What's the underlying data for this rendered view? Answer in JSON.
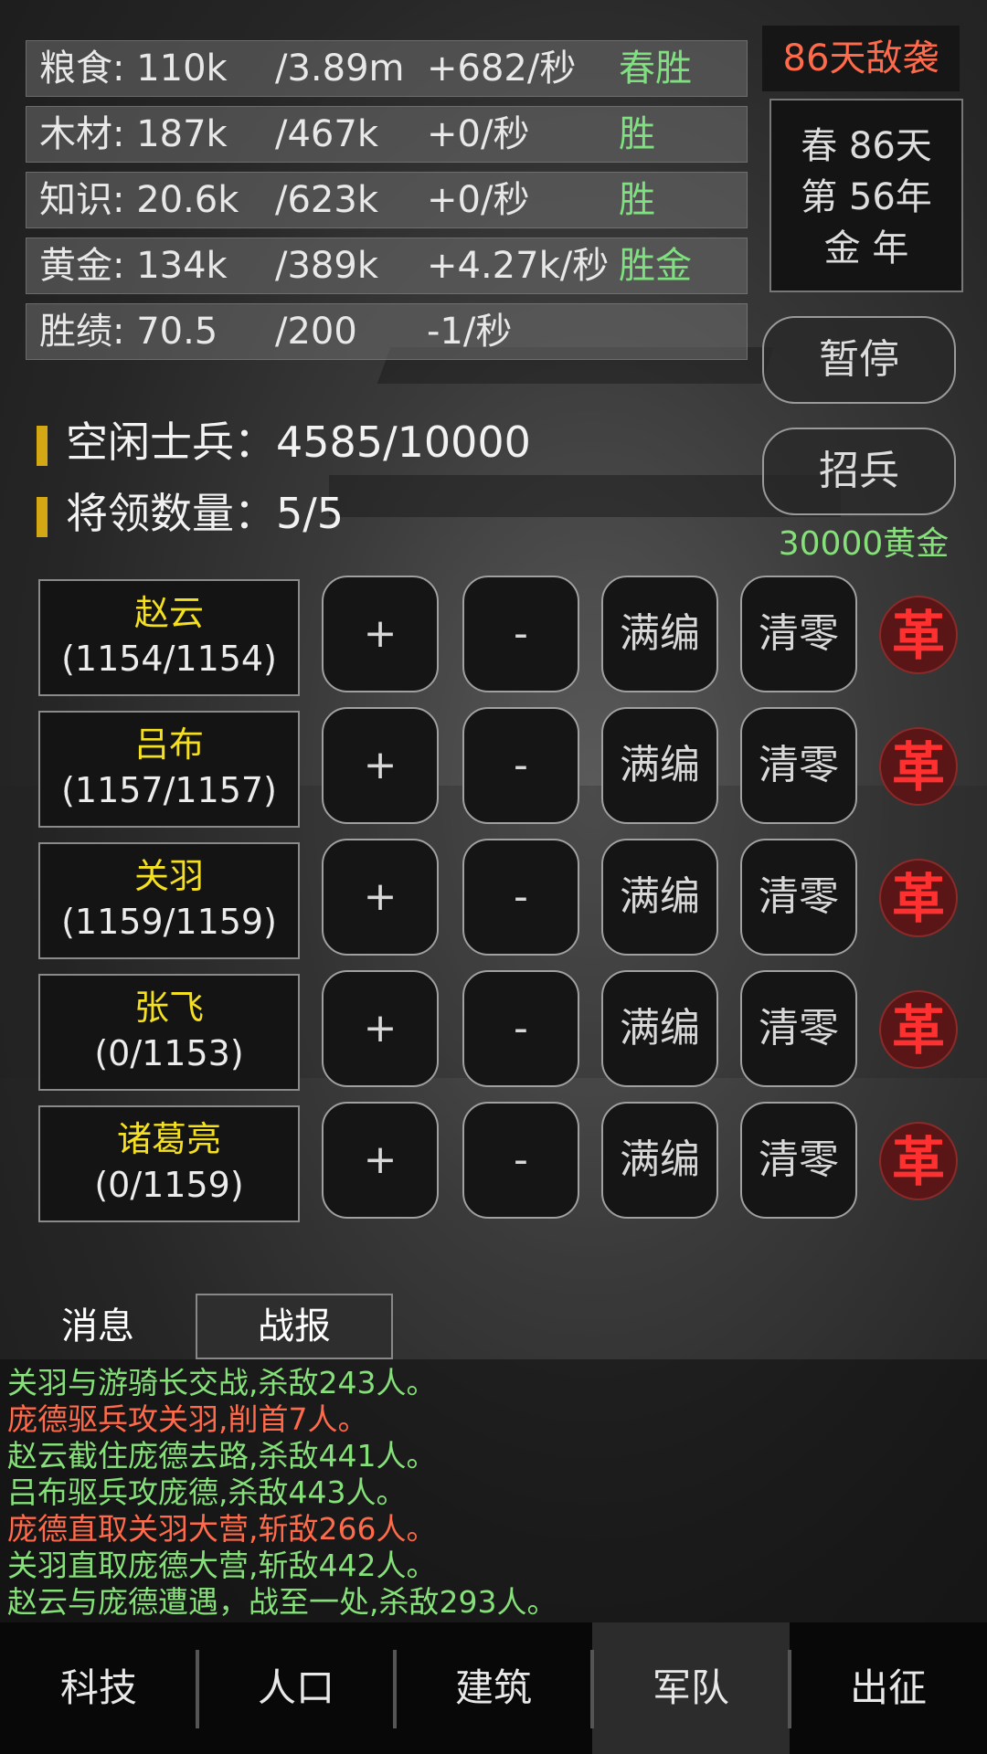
{
  "resources": [
    {
      "name": "粮食: 110k",
      "cap": "/3.89m",
      "rate": "+682/秒",
      "tag": "春胜"
    },
    {
      "name": "木材: 187k",
      "cap": "/467k",
      "rate": "+0/秒",
      "tag": "胜"
    },
    {
      "name": "知识: 20.6k",
      "cap": "/623k",
      "rate": "+0/秒",
      "tag": "胜"
    },
    {
      "name": "黄金: 134k",
      "cap": "/389k",
      "rate": "+4.27k/秒",
      "tag": "胜金"
    },
    {
      "name": "胜绩: 70.5",
      "cap": "/200",
      "rate": "-1/秒",
      "tag": ""
    }
  ],
  "enemy_warning": "86天敌袭",
  "date": {
    "line1": "春 86天",
    "line2": "第 56年",
    "line3": "金 年"
  },
  "buttons": {
    "pause": "暂停",
    "recruit": "招兵",
    "recruit_cost": "30000黄金"
  },
  "stats": {
    "idle_soldiers": "空闲士兵：4585/10000",
    "generals": "将领数量：5/5"
  },
  "generals": [
    {
      "name": "赵云",
      "count": "(1154/1154)"
    },
    {
      "name": "吕布",
      "count": "(1157/1157)"
    },
    {
      "name": "关羽",
      "count": "(1159/1159)"
    },
    {
      "name": "张飞",
      "count": "(0/1153)"
    },
    {
      "name": "诸葛亮",
      "count": "(0/1159)"
    }
  ],
  "row_buttons": {
    "plus": "+",
    "minus": "-",
    "full": "满编",
    "clear": "清零",
    "dismiss": "革"
  },
  "tabs": {
    "messages": "消息",
    "battle_report": "战报"
  },
  "log": [
    {
      "text": "关羽与游骑长交战,杀敌243人。",
      "color": "#86e07a"
    },
    {
      "text": "庞德驱兵攻关羽,削首7人。",
      "color": "#ff6a4a"
    },
    {
      "text": "赵云截住庞德去路,杀敌441人。",
      "color": "#86e07a"
    },
    {
      "text": "吕布驱兵攻庞德,杀敌443人。",
      "color": "#86e07a"
    },
    {
      "text": "庞德直取关羽大营,斩敌266人。",
      "color": "#ff6a4a"
    },
    {
      "text": "关羽直取庞德大营,斩敌442人。",
      "color": "#86e07a"
    },
    {
      "text": "赵云与庞德遭遇，战至一处,杀敌293人。",
      "color": "#86e07a"
    }
  ],
  "nav": [
    "科技",
    "人口",
    "建筑",
    "军队",
    "出征"
  ],
  "nav_active": "军队"
}
